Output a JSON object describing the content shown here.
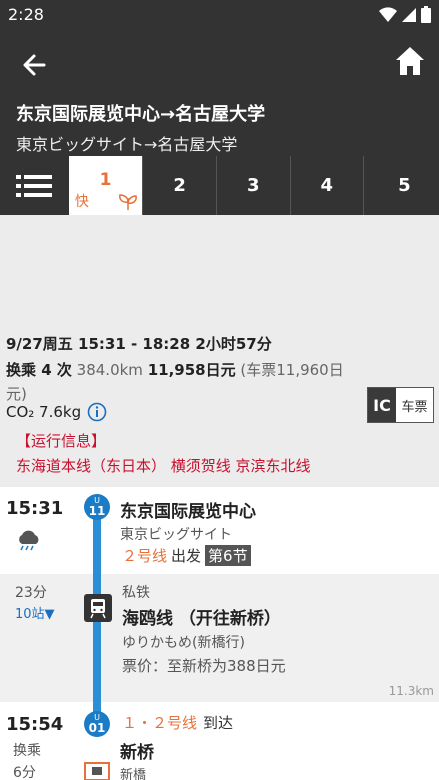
{
  "status_bar": {
    "time": "2:28"
  },
  "header": {
    "title_cn": "东京国际展览中心→名古屋大学",
    "title_jp": "東京ビッグサイト→名古屋大学"
  },
  "tabs": {
    "items": [
      {
        "label": "1",
        "tag_fast": "快",
        "tag_eco": "eco-leaf-icon",
        "active": true
      },
      {
        "label": "2"
      },
      {
        "label": "3"
      },
      {
        "label": "4"
      },
      {
        "label": "5"
      }
    ]
  },
  "summary": {
    "date_time": "9/27周五 15:31 - 18:28 2小时57分",
    "transfers": "换乘 4 次",
    "distance": "384.0km",
    "fare": "11,958日元",
    "fare_ticket": "(车票11,960日元)",
    "co2_label": "CO₂ 7.6kg",
    "ic_label": "IC",
    "ticket_label": "车票",
    "service_info_title": "【运行信息】",
    "service_lines": "东海道本线（东日本） 横须贺线 京滨东北线"
  },
  "route": {
    "stop1": {
      "time": "15:31",
      "weather_icon": "rain-cloud-icon",
      "badge_prefix": "U",
      "badge_num": "11",
      "name_cn": "东京国际展览中心",
      "name_jp": "東京ビッグサイト",
      "platform": "２号线",
      "depart": "出发",
      "car": "第6节"
    },
    "segment": {
      "duration": "23分",
      "stops": "10站▼",
      "type": "私铁",
      "line_name": "海鸥线  （开往新桥）",
      "line_jp": "ゆりかもめ(新橋行)",
      "fare": "票价：至新桥为388日元",
      "distance": "11.3km"
    },
    "stop2": {
      "time": "15:54",
      "transfer": "换乘",
      "transfer_time": "6分",
      "badge_prefix": "U",
      "badge_num": "01",
      "platform": "１・２号线",
      "arrive": "到达",
      "name_cn": "新桥",
      "name_jp": "新橋"
    }
  },
  "colors": {
    "header_bg": "#333333",
    "accent_orange": "#e8703a",
    "line_blue": "#2a8fd6",
    "service_red": "#c8102e"
  }
}
